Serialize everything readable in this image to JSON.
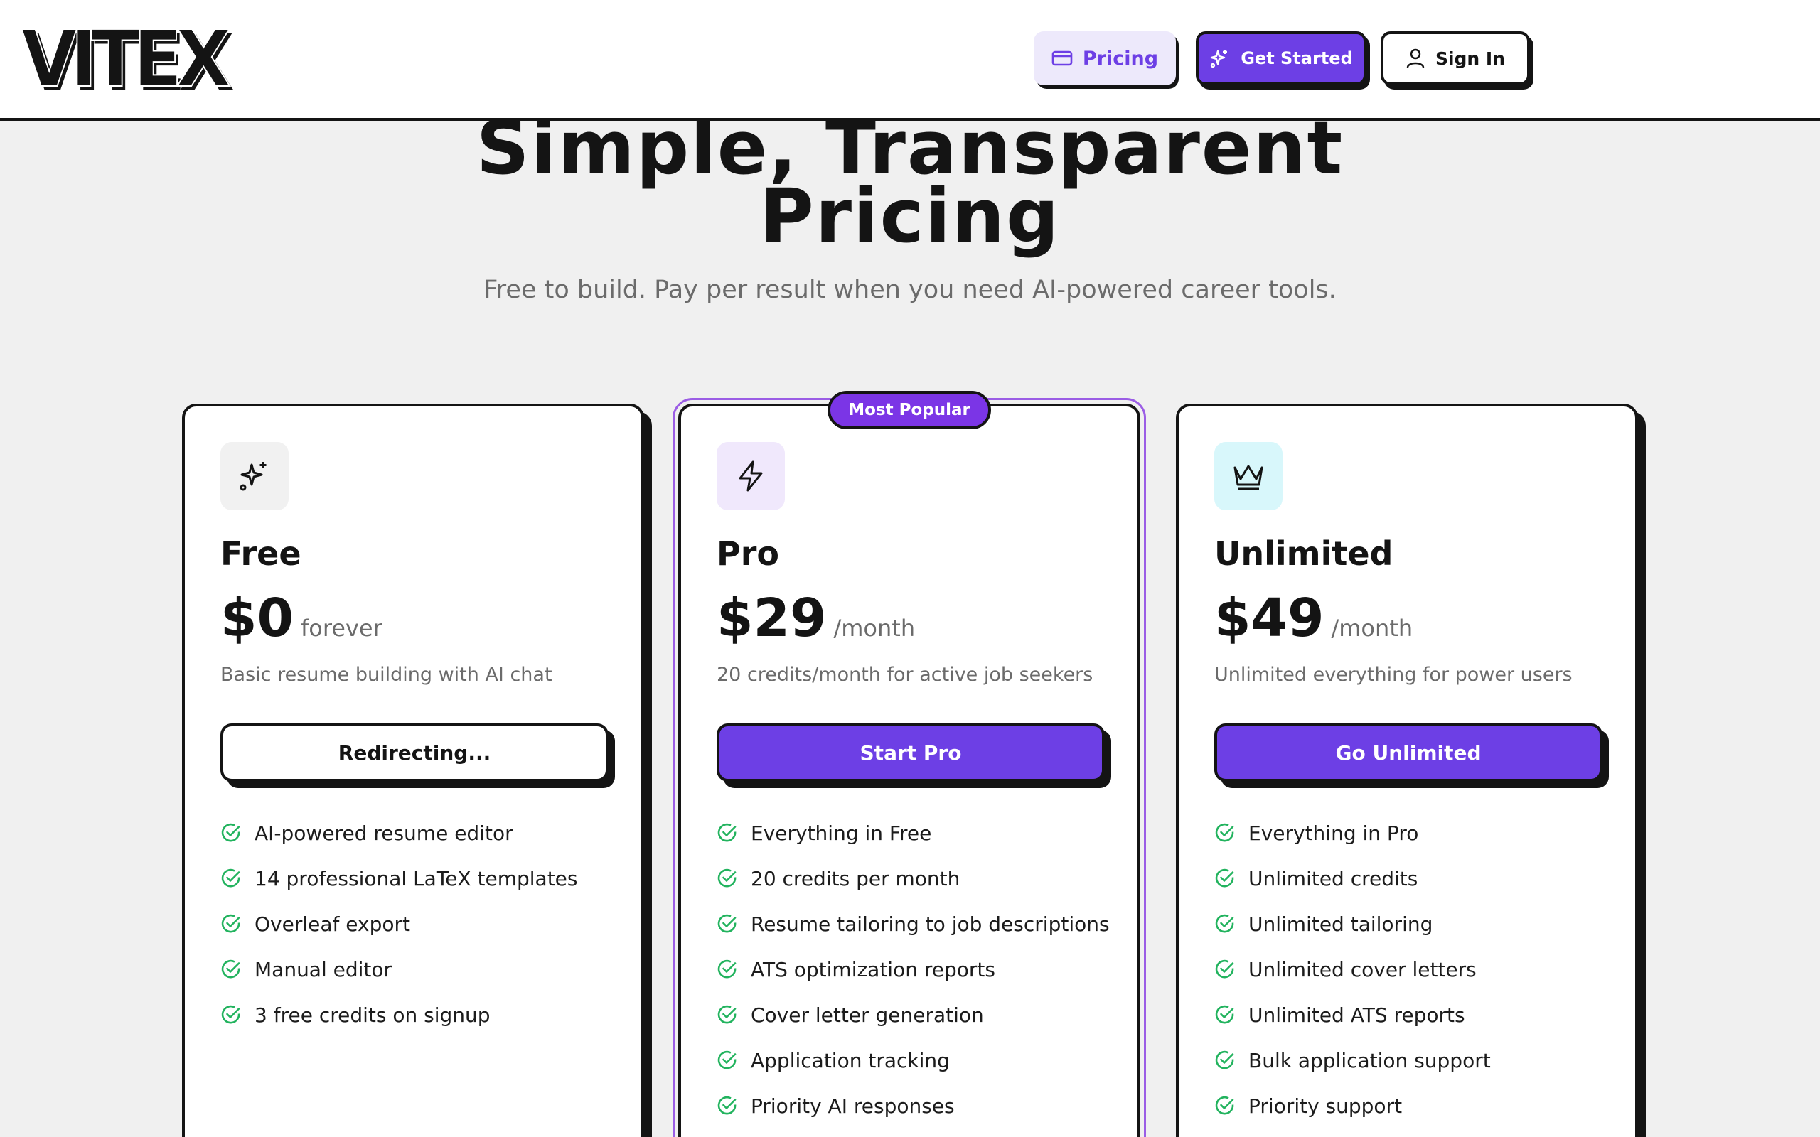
{
  "header": {
    "logo": "VITEX",
    "nav": {
      "pricing_label": "Pricing",
      "get_started_label": "Get Started",
      "sign_in_label": "Sign In"
    }
  },
  "hero": {
    "title_line1": "Simple, Transparent",
    "title_line2": "Pricing",
    "subtitle": "Free to build. Pay per result when you need AI-powered career tools."
  },
  "plans": [
    {
      "name": "Free",
      "price": "$0",
      "period": "forever",
      "description": "Basic resume building with AI chat",
      "cta": "Redirecting...",
      "icon": "sparkles-icon",
      "features": [
        "AI-powered resume editor",
        "14 professional LaTeX templates",
        "Overleaf export",
        "Manual editor",
        "3 free credits on signup"
      ]
    },
    {
      "name": "Pro",
      "badge": "Most Popular",
      "price": "$29",
      "period": "/month",
      "description": "20 credits/month for active job seekers",
      "cta": "Start Pro",
      "icon": "lightning-icon",
      "features": [
        "Everything in Free",
        "20 credits per month",
        "Resume tailoring to job descriptions",
        "ATS optimization reports",
        "Cover letter generation",
        "Application tracking",
        "Priority AI responses"
      ]
    },
    {
      "name": "Unlimited",
      "price": "$49",
      "period": "/month",
      "description": "Unlimited everything for power users",
      "cta": "Go Unlimited",
      "icon": "crown-icon",
      "features": [
        "Everything in Pro",
        "Unlimited credits",
        "Unlimited tailoring",
        "Unlimited cover letters",
        "Unlimited ATS reports",
        "Bulk application support",
        "Priority support"
      ]
    }
  ],
  "colors": {
    "accent": "#6d3fe5",
    "badge": "#7b35e6",
    "check": "#22b35e",
    "background": "#f0f0f0",
    "ink": "#141414"
  }
}
